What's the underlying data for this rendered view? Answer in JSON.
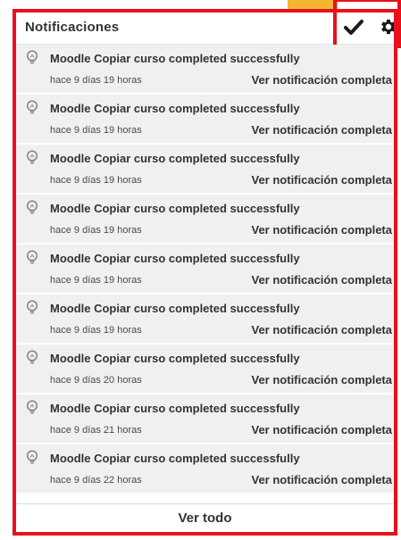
{
  "colors": {
    "frame_red": "#e8101a",
    "accent_yellow": "#f5b731",
    "item_background": "#f0f0f0",
    "text_dark": "#333333"
  },
  "header": {
    "title": "Notificaciones",
    "mark_all_read_icon": "checkmark-icon",
    "settings_icon": "gear-icon"
  },
  "notifications": [
    {
      "icon": "lightbulb-icon",
      "title": "Moodle Copiar curso completed successfully",
      "time": "hace 9 días 19 horas",
      "link": "Ver notificación completa"
    },
    {
      "icon": "lightbulb-icon",
      "title": "Moodle Copiar curso completed successfully",
      "time": "hace 9 días 19 horas",
      "link": "Ver notificación completa"
    },
    {
      "icon": "lightbulb-icon",
      "title": "Moodle Copiar curso completed successfully",
      "time": "hace 9 días 19 horas",
      "link": "Ver notificación completa"
    },
    {
      "icon": "lightbulb-icon",
      "title": "Moodle Copiar curso completed successfully",
      "time": "hace 9 días 19 horas",
      "link": "Ver notificación completa"
    },
    {
      "icon": "lightbulb-icon",
      "title": "Moodle Copiar curso completed successfully",
      "time": "hace 9 días 19 horas",
      "link": "Ver notificación completa"
    },
    {
      "icon": "lightbulb-icon",
      "title": "Moodle Copiar curso completed successfully",
      "time": "hace 9 días 19 horas",
      "link": "Ver notificación completa"
    },
    {
      "icon": "lightbulb-icon",
      "title": "Moodle Copiar curso completed successfully",
      "time": "hace 9 días 20 horas",
      "link": "Ver notificación completa"
    },
    {
      "icon": "lightbulb-icon",
      "title": "Moodle Copiar curso completed successfully",
      "time": "hace 9 días 21 horas",
      "link": "Ver notificación completa"
    },
    {
      "icon": "lightbulb-icon",
      "title": "Moodle Copiar curso completed successfully",
      "time": "hace 9 días 22 horas",
      "link": "Ver notificación completa"
    }
  ],
  "footer": {
    "view_all_label": "Ver todo"
  }
}
